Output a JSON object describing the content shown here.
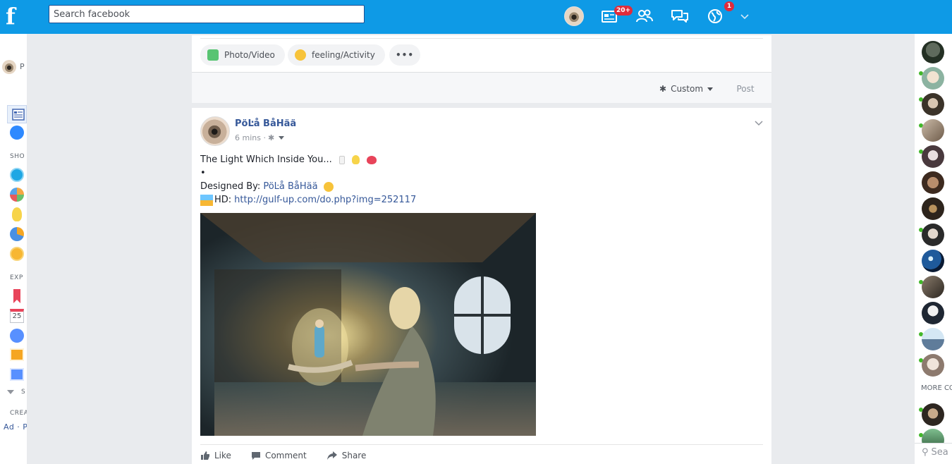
{
  "topbar": {
    "logo": "f",
    "search_placeholder": "Search facebook",
    "icons": [
      "profile-avatar",
      "news-icon",
      "friend-requests-icon",
      "messages-icon",
      "notifications-icon",
      "chevron-down-icon"
    ],
    "news_badge": "20+",
    "notifications_badge": "1",
    "brand_color": "#0e9ae6"
  },
  "left_sidebar": {
    "profile_initial": "P",
    "section_shortcuts": "SHO",
    "section_explore": "EXP",
    "calendar_day": "25",
    "see_more": "S",
    "create_label": "CREA",
    "ad_label": "Ad · P"
  },
  "composer": {
    "photo_video": "Photo/Video",
    "feeling_activity": "feeling/Activity",
    "more": "•••",
    "audience": "Custom",
    "post": "Post"
  },
  "post": {
    "author": "PöĿå BåHää",
    "time": "6 mins ·",
    "line1": "The Light Which Inside You...",
    "bullet": "•",
    "designed_by_label": "Designed By:",
    "designed_by_name": "PöĿå BåHää",
    "hd_label": "HD:",
    "hd_link": "http://gulf-up.com/do.php?img=252117",
    "actions": {
      "like": "Like",
      "comment": "Comment",
      "share": "Share"
    }
  },
  "right_sidebar": {
    "more_contacts_label": "MORE CO",
    "search_placeholder": "Sea"
  }
}
